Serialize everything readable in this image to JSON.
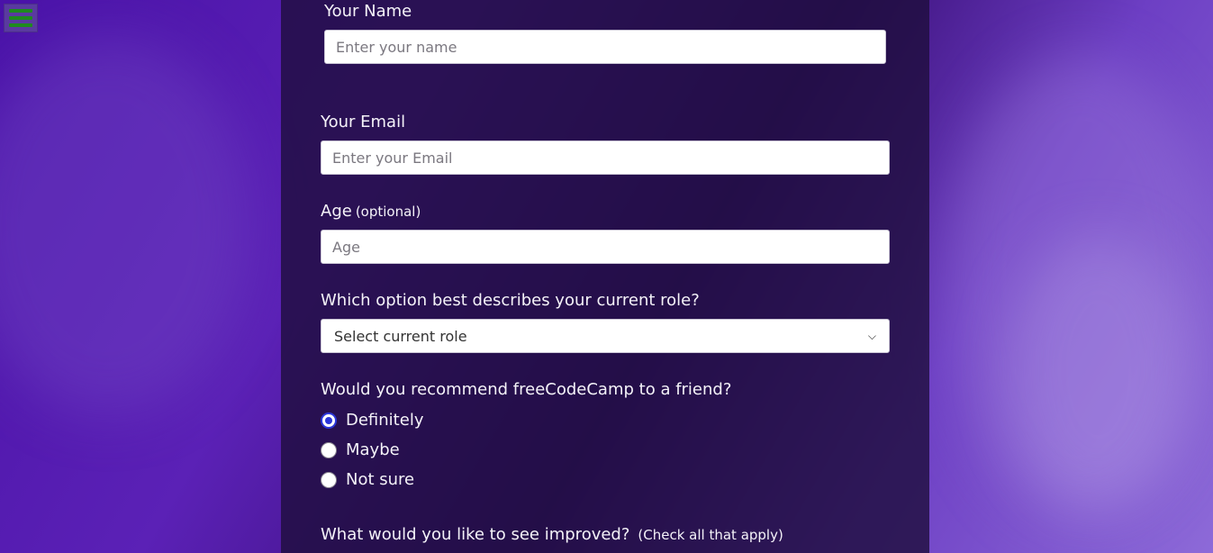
{
  "menu": {
    "icon": "hamburger-menu-icon"
  },
  "form": {
    "name": {
      "label": "Your Name",
      "placeholder": "Enter your name"
    },
    "email": {
      "label": "Your Email",
      "placeholder": "Enter your Email"
    },
    "age": {
      "label": "Age",
      "optional": "(optional)",
      "placeholder": "Age"
    },
    "role": {
      "label": "Which option best describes your current role?",
      "selected": "Select current role"
    },
    "recommend": {
      "label": "Would you recommend freeCodeCamp to a friend?",
      "options": [
        "Definitely",
        "Maybe",
        "Not sure"
      ],
      "selected": "Definitely"
    },
    "improve": {
      "label": "What would you like to see improved?",
      "hint": "(Check all that apply)"
    }
  },
  "colors": {
    "accent": "#2b36d9",
    "menu_icon": "#1f8a1f",
    "panel": "#1e0e3c"
  }
}
